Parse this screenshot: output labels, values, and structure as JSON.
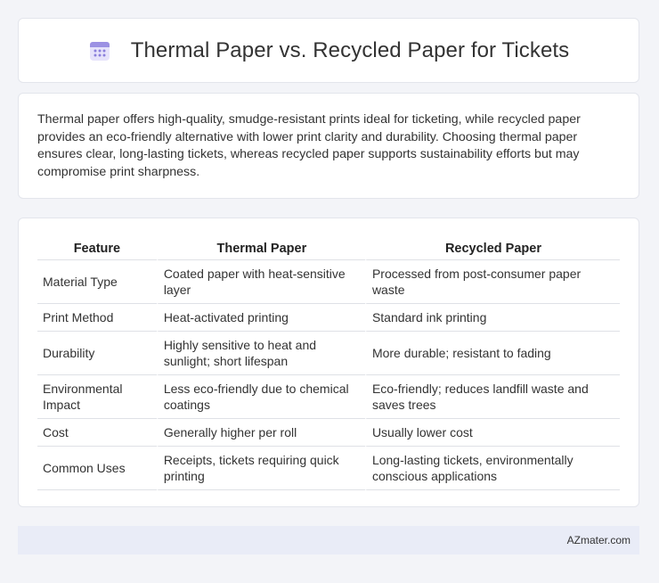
{
  "header": {
    "icon": "calendar-icon",
    "title": "Thermal Paper vs. Recycled Paper for Tickets"
  },
  "intro": {
    "text": "Thermal paper offers high-quality, smudge-resistant prints ideal for ticketing, while recycled paper provides an eco-friendly alternative with lower print clarity and durability. Choosing thermal paper ensures clear, long-lasting tickets, whereas recycled paper supports sustainability efforts but may compromise print sharpness."
  },
  "table": {
    "headers": [
      "Feature",
      "Thermal Paper",
      "Recycled Paper"
    ],
    "rows": [
      [
        "Material Type",
        "Coated paper with heat-sensitive layer",
        "Processed from post-consumer paper waste"
      ],
      [
        "Print Method",
        "Heat-activated printing",
        "Standard ink printing"
      ],
      [
        "Durability",
        "Highly sensitive to heat and sunlight; short lifespan",
        "More durable; resistant to fading"
      ],
      [
        "Environmental Impact",
        "Less eco-friendly due to chemical coatings",
        "Eco-friendly; reduces landfill waste and saves trees"
      ],
      [
        "Cost",
        "Generally higher per roll",
        "Usually lower cost"
      ],
      [
        "Common Uses",
        "Receipts, tickets requiring quick printing",
        "Long-lasting tickets, environmentally conscious applications"
      ]
    ]
  },
  "footer": {
    "brand": "AZmater.com"
  },
  "colors": {
    "icon_accent": "#7b6fd6",
    "footer_bg": "#e9ecf7"
  }
}
